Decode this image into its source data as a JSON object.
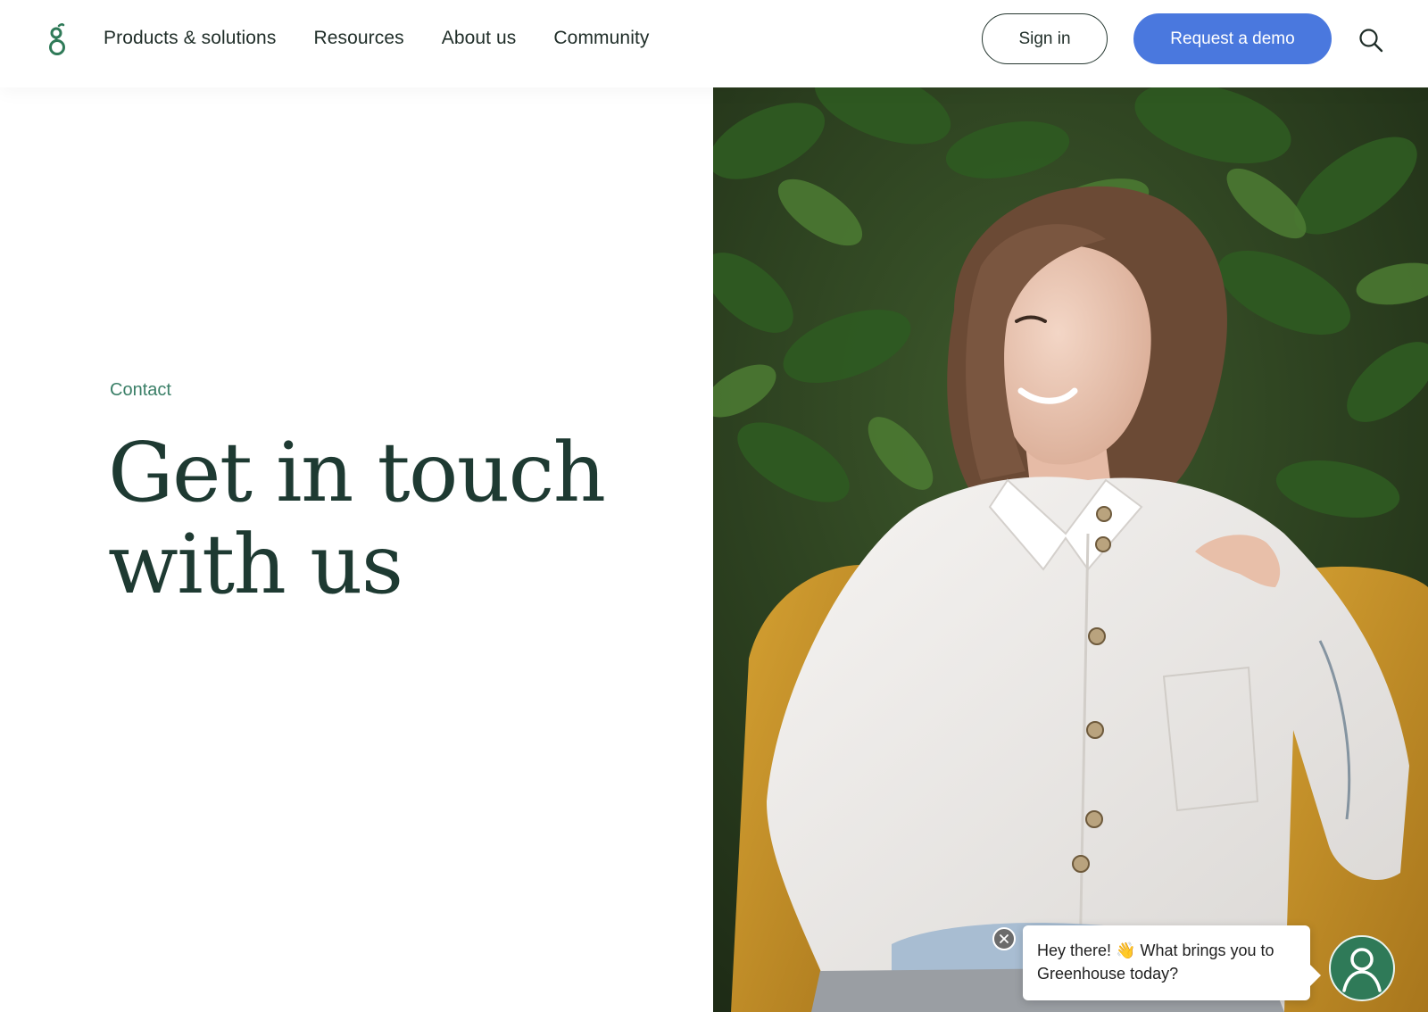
{
  "brand": {
    "logo_icon": "greenhouse-g-logo-icon",
    "logo_color": "#2f7a58"
  },
  "nav": {
    "items": [
      {
        "label": "Products & solutions"
      },
      {
        "label": "Resources"
      },
      {
        "label": "About us"
      },
      {
        "label": "Community"
      }
    ],
    "sign_in_label": "Sign in",
    "demo_label": "Request a demo",
    "search_icon": "search-icon"
  },
  "hero": {
    "eyebrow": "Contact",
    "headline_line1": "Get in touch",
    "headline_line2": "with us",
    "photo_icon": "hero-photo-woman-smiling"
  },
  "chat": {
    "message": "Hey there! 👋 What brings you to Greenhouse today?",
    "close_icon": "close-icon",
    "avatar_icon": "user-avatar-icon"
  },
  "colors": {
    "accent_blue": "#4a78de",
    "brand_green": "#2f7a58",
    "headline": "#1e3a32",
    "eyebrow": "#3a7f67"
  }
}
